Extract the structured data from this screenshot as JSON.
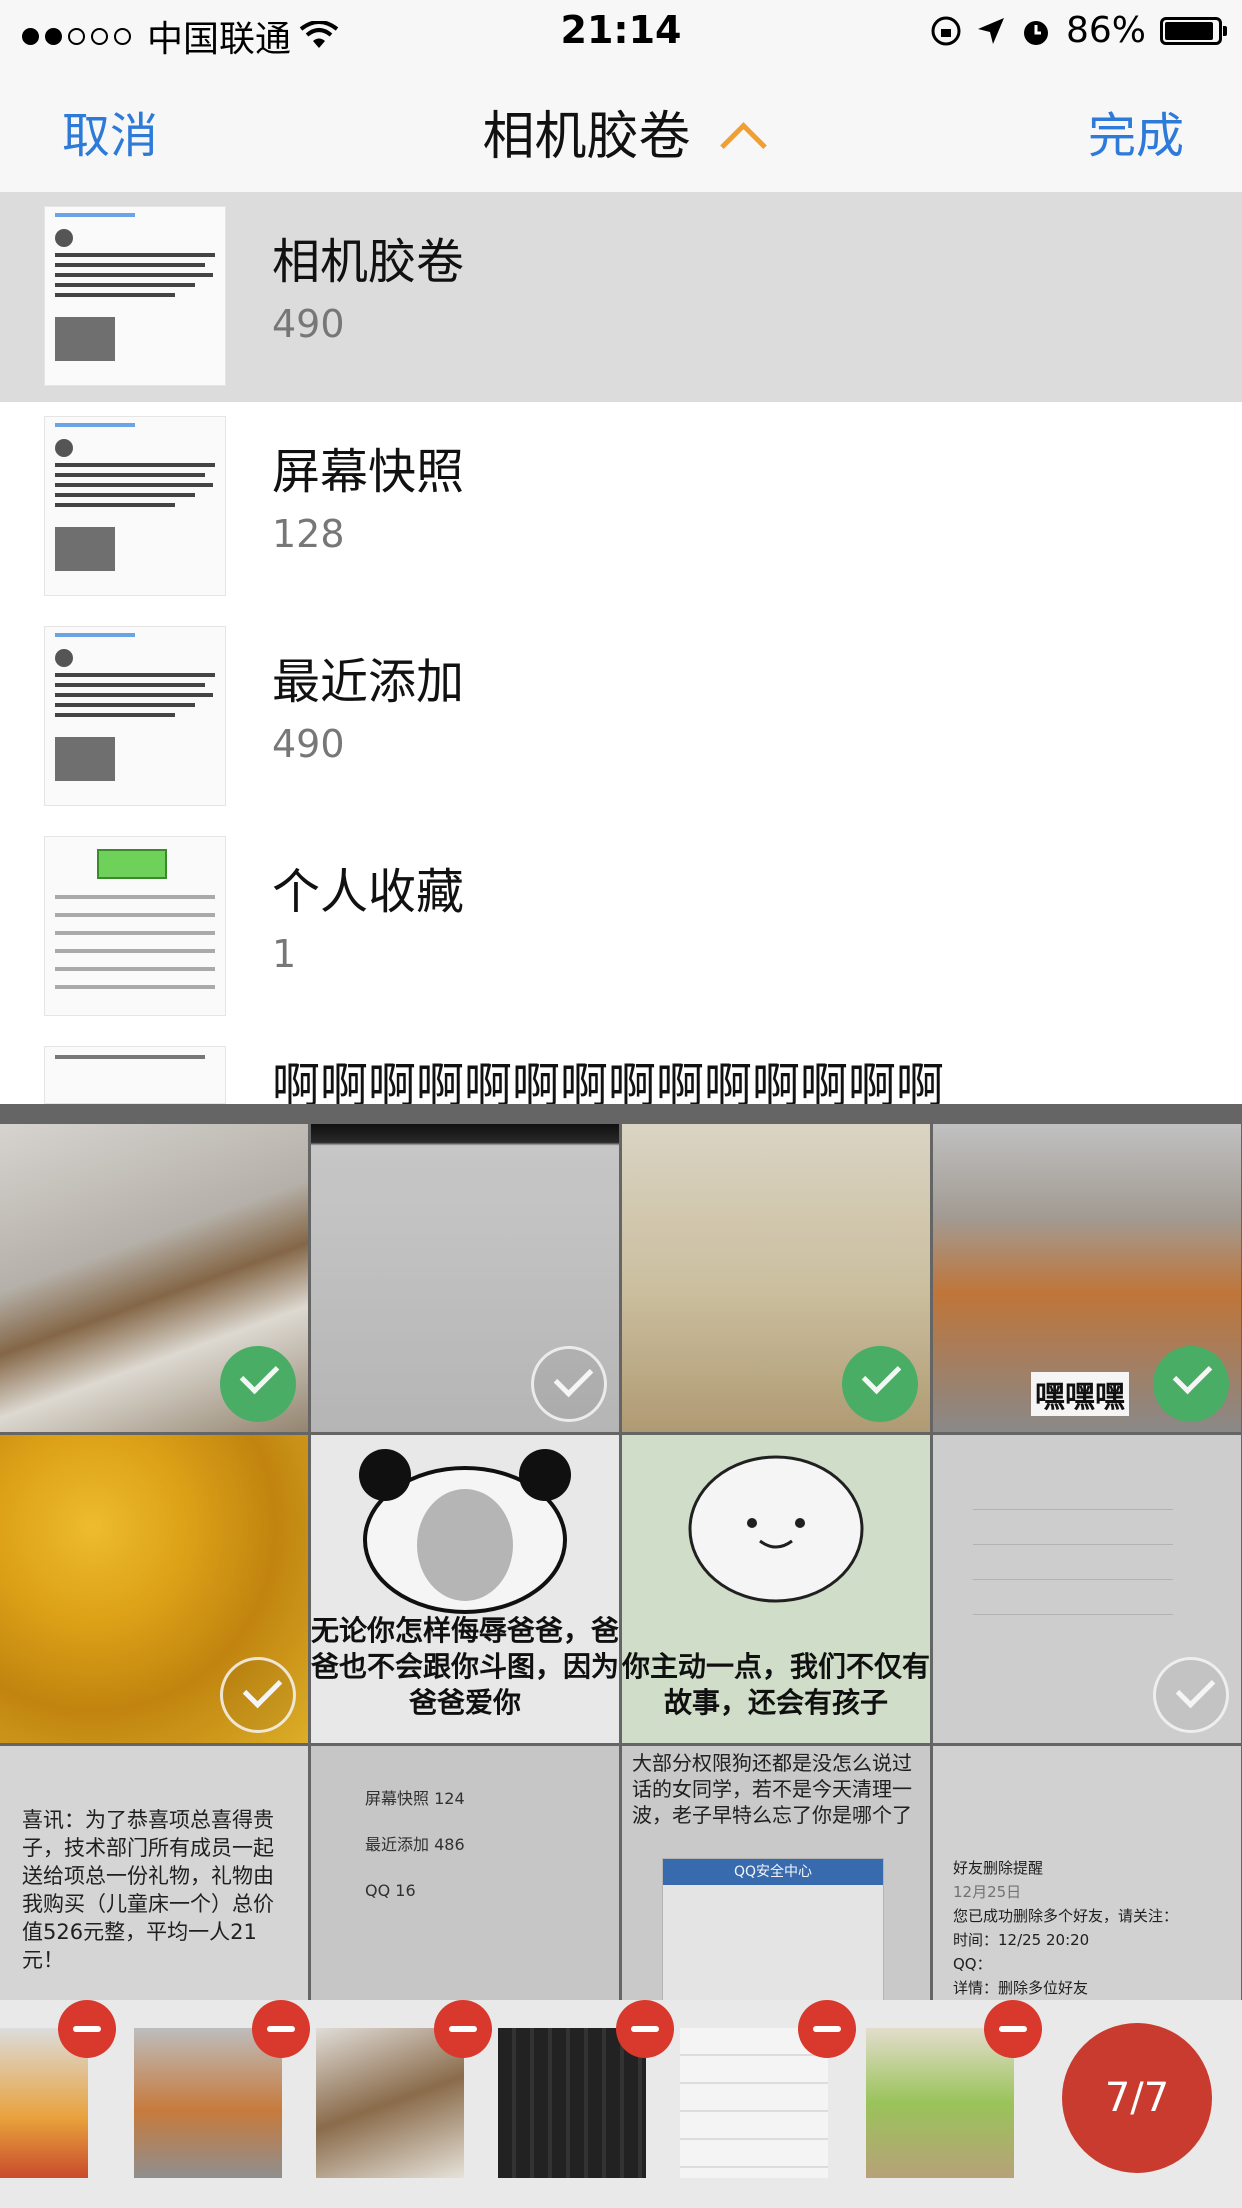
{
  "status_bar": {
    "carrier": "中国联通",
    "time": "21:14",
    "battery": "86%"
  },
  "nav": {
    "cancel": "取消",
    "title": "相机胶卷",
    "done": "完成"
  },
  "albums": [
    {
      "name": "相机胶卷",
      "count": "490",
      "selected": true
    },
    {
      "name": "屏幕快照",
      "count": "128",
      "selected": false
    },
    {
      "name": "最近添加",
      "count": "490",
      "selected": false
    },
    {
      "name": "个人收藏",
      "count": "1",
      "selected": false
    },
    {
      "name": "啊啊啊啊啊啊啊啊啊啊啊啊啊啊",
      "count": "",
      "selected": false
    }
  ],
  "grid": {
    "memes": {
      "dog_caption": "嘿嘿嘿",
      "panda_caption": "无论你怎样侮辱爸爸，爸爸也不会跟你斗图，因为爸爸爱你",
      "blob_caption": "你主动一点，我们不仅有故事，还会有孩子"
    },
    "text_cell": "喜讯：为了恭喜项总喜得贵子，技术部门所有成员一起送给项总一份礼物，礼物由我购买（儿童床一个）总价值526元整，平均一人21元！",
    "screenshot_list": [
      "屏幕快照 124",
      "最近添加 486",
      "QQ 16"
    ],
    "article_text": "大部分权限狗还都是没怎么说过话的女同学，若不是今天清理一波，老子早特么忘了你是哪个了",
    "article_app": "QQ安全中心",
    "friend_text": {
      "title": "好友删除提醒",
      "date": "12月25日",
      "body": "您已成功删除多个好友，请关注：",
      "time": "时间：12/25 20:20",
      "qq": "QQ：",
      "detail": "详情：删除多位好友"
    }
  },
  "tray": {
    "counter": "7/7"
  }
}
